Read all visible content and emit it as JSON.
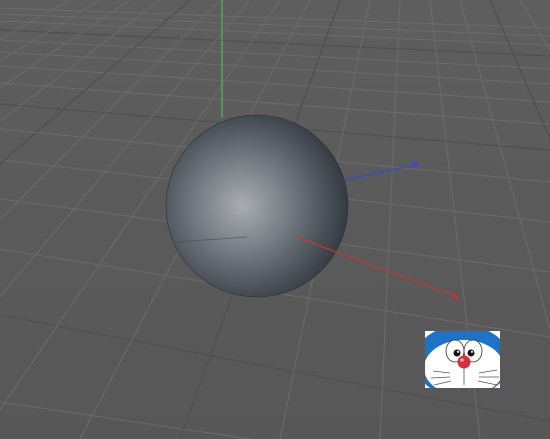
{
  "viewport": {
    "background_color": "#5b5b5b",
    "grid_color": "#6f6f6f",
    "grid_major_color": "#4f4f4f",
    "axis_x_color": "#c0392b",
    "axis_y_color": "#2ecc71",
    "axis_z_color": "#2c3fd6"
  },
  "object": {
    "type": "sphere",
    "shading": "smooth-gray"
  },
  "thumbnail": {
    "icon": "doraemon-face-icon"
  }
}
